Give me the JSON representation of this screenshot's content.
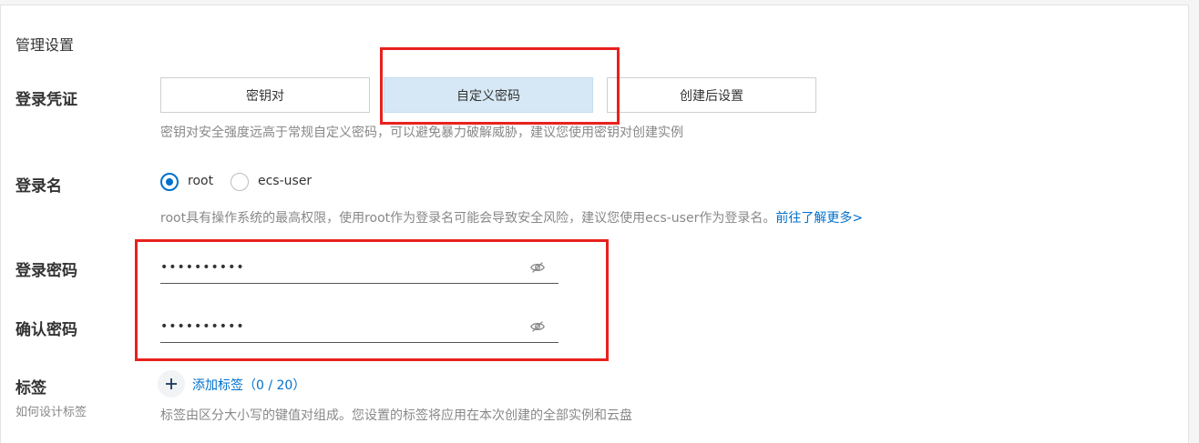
{
  "section": {
    "title": "管理设置"
  },
  "credential": {
    "label": "登录凭证",
    "options": [
      "密钥对",
      "自定义密码",
      "创建后设置"
    ],
    "selected": "自定义密码",
    "hint": "密钥对安全强度远高于常规自定义密码，可以避免暴力破解威胁，建议您使用密钥对创建实例"
  },
  "login_name": {
    "label": "登录名",
    "options": [
      "root",
      "ecs-user"
    ],
    "selected": "root",
    "hint": "root具有操作系统的最高权限，使用root作为登录名可能会导致安全风险，建议您使用ecs-user作为登录名。",
    "link": "前往了解更多>"
  },
  "password": {
    "label": "登录密码",
    "value": "••••••••••"
  },
  "confirm_password": {
    "label": "确认密码",
    "value": "••••••••••"
  },
  "tags": {
    "label": "标签",
    "sub_label": "如何设计标签",
    "add_label": "添加标签",
    "count": "（0 / 20）",
    "hint": "标签由区分大小写的键值对组成。您设置的标签将应用在本次创建的全部实例和云盘"
  },
  "colors": {
    "accent": "#0070cc",
    "selected_bg": "#d6e8f5",
    "annotation_red": "#e8211d"
  },
  "icons": {
    "eye": "eye-off-icon",
    "plus": "plus-icon"
  }
}
